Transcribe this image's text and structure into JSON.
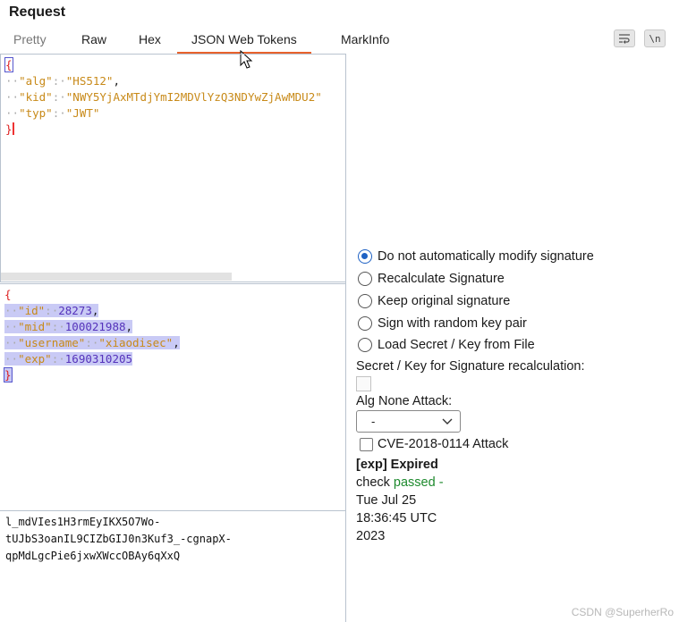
{
  "panel_title": "Request",
  "tabs": [
    {
      "label": "Pretty"
    },
    {
      "label": "Raw"
    },
    {
      "label": "Hex"
    },
    {
      "label": "JSON Web Tokens"
    },
    {
      "label": "MarkInfo"
    }
  ],
  "toolbar": {
    "wrap_icon": "wrap-lines-icon",
    "newline_label": "\\n"
  },
  "header_json": {
    "open": "{",
    "close": "}",
    "rows": [
      {
        "key": "\"alg\"",
        "value": "\"HS512\"",
        "trail": ","
      },
      {
        "key": "\"kid\"",
        "value": "\"NWY5YjAxMTdjYmI2MDVlYzQ3NDYwZjAwMDU2\"",
        "trail": ""
      },
      {
        "key": "\"typ\"",
        "value": "\"JWT\"",
        "trail": ""
      }
    ]
  },
  "payload_json": {
    "open": "{",
    "close": "}",
    "rows": [
      {
        "key": "\"id\"",
        "value": "28273",
        "trail": ","
      },
      {
        "key": "\"mid\"",
        "value": "100021988",
        "trail": ","
      },
      {
        "key": "\"username\"",
        "value": "\"xiaodisec\"",
        "trail": ","
      },
      {
        "key": "\"exp\"",
        "value": "1690310205",
        "trail": ""
      }
    ]
  },
  "signature_lines": [
    "l_mdVIes1H3rmEyIKX5O7Wo-",
    "tUJbS3oanIL9CIZbGIJ0n3Kuf3_-cgnapX-",
    "qpMdLgcPie6jxwXWccOBAy6qXxQ"
  ],
  "signature_options": [
    {
      "label": "Do not automatically modify signature",
      "checked": true
    },
    {
      "label": "Recalculate Signature",
      "checked": false
    },
    {
      "label": "Keep original signature",
      "checked": false
    },
    {
      "label": "Sign with random key pair",
      "checked": false
    },
    {
      "label": "Load Secret / Key from File",
      "checked": false
    }
  ],
  "secret_label": "Secret / Key for Signature recalculation:",
  "alg_none_label": "Alg None Attack:",
  "alg_none_selected": "-",
  "cve_label": "CVE-2018-0114 Attack",
  "exp_status": {
    "title": "[exp] Expired",
    "check_word": "check",
    "passed_word": "passed -",
    "date_lines": [
      "Tue Jul 25",
      "18:36:45 UTC",
      "2023"
    ]
  },
  "watermark": "CSDN @SuperherRo",
  "colors": {
    "accent": "#e8622c",
    "radio": "#1f62c4",
    "passed": "#1e8a2e",
    "selection": "#c9caf5"
  }
}
